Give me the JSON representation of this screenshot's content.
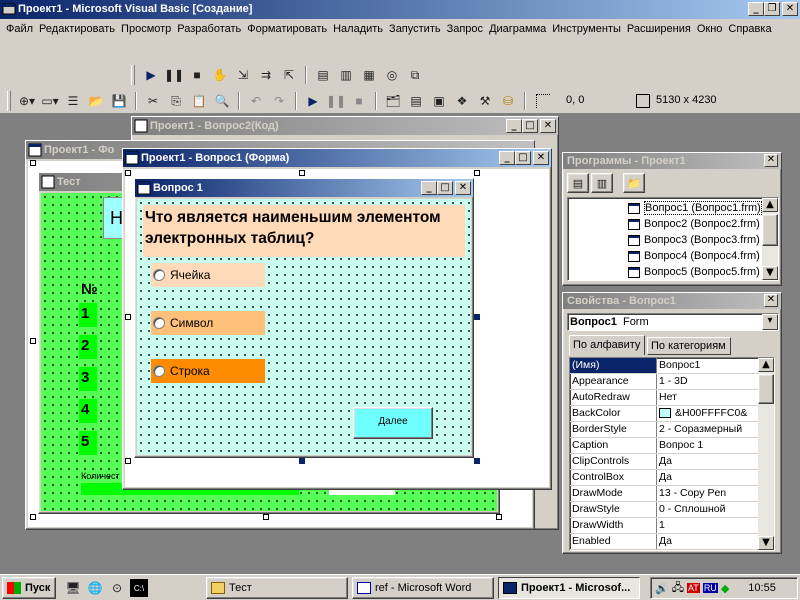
{
  "app": {
    "title": "Проект1 - Microsoft Visual Basic [Создание]"
  },
  "menu": [
    "Файл",
    "Редактировать",
    "Просмотр",
    "Разработать",
    "Форматировать",
    "Наладить",
    "Запустить",
    "Запрос",
    "Диаграмма",
    "Инструменты",
    "Расширения",
    "Окно",
    "Справка"
  ],
  "toolbar": {
    "coords": "0, 0",
    "size": "5130 x 4230"
  },
  "windows": {
    "code": "Проект1 - Вопрос2(Код)",
    "back_form": "Проект1 - Фо",
    "form_designer": "Проект1 - Вопрос1 (Форма)",
    "test": "Тест"
  },
  "back": {
    "header_text": "Н",
    "number_header": "№",
    "numbers": [
      "1",
      "2",
      "3",
      "4",
      "5"
    ],
    "count_label": "Количест"
  },
  "form": {
    "title": "Вопрос 1",
    "question": "Что является наименьшим элементом электронных таблиц?",
    "options": [
      {
        "label": "Ячейка",
        "color": "#ffdab9"
      },
      {
        "label": "Символ",
        "color": "#ffc07a"
      },
      {
        "label": "Строка",
        "color": "#ff8c00"
      }
    ],
    "next_button": "Далее"
  },
  "programs": {
    "title": "Программы - Проект1",
    "items": [
      "Вопрос1 (Вопрос1.frm)",
      "Вопрос2 (Вопрос2.frm)",
      "Вопрос3 (Вопрос3.frm)",
      "Вопрос4 (Вопрос4.frm)",
      "Вопрос5 (Вопрос5.frm)"
    ]
  },
  "properties": {
    "title": "Свойства - Вопрос1",
    "object_name": "Вопрос1",
    "object_type": "Form",
    "tab_alpha": "По алфавиту",
    "tab_category": "По категориям",
    "rows": [
      {
        "name": "(Имя)",
        "value": "Вопрос1"
      },
      {
        "name": "Appearance",
        "value": "1 - 3D"
      },
      {
        "name": "AutoRedraw",
        "value": "Нет"
      },
      {
        "name": "BackColor",
        "value": "&H00FFFFC0&"
      },
      {
        "name": "BorderStyle",
        "value": "2 - Соразмерный"
      },
      {
        "name": "Caption",
        "value": "Вопрос 1"
      },
      {
        "name": "ClipControls",
        "value": "Да"
      },
      {
        "name": "ControlBox",
        "value": "Да"
      },
      {
        "name": "DrawMode",
        "value": "13 - Copy Pen"
      },
      {
        "name": "DrawStyle",
        "value": "0 - Сплошной"
      },
      {
        "name": "DrawWidth",
        "value": "1"
      },
      {
        "name": "Enabled",
        "value": "Да"
      }
    ]
  },
  "taskbar": {
    "start": "Пуск",
    "tasks": [
      "Тест",
      "ref - Microsoft Word",
      "Проект1 - Microsof..."
    ],
    "lang": "RU",
    "clock": "10:55"
  },
  "colors": {
    "accent": "#0a246a",
    "face": "#d4d0c8",
    "form_bg": "#c8fdf0",
    "green": "#00ff00"
  }
}
